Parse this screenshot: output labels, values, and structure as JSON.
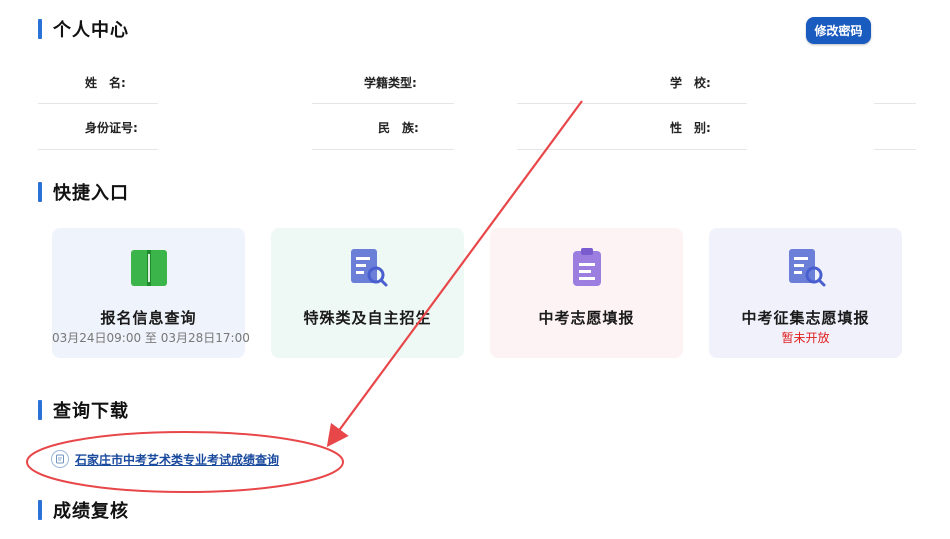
{
  "profile": {
    "title": "个人中心",
    "change_password": "修改密码",
    "fields": {
      "name": "姓　名:",
      "enroll_type": "学籍类型:",
      "school": "学　校:",
      "id_number": "身份证号:",
      "ethnicity": "民　族:",
      "gender": "性　别:"
    }
  },
  "shortcuts": {
    "title": "快捷入口",
    "cards": [
      {
        "name": "报名信息查询",
        "sub": "03月24日09:00 至 03月28日17:00"
      },
      {
        "name": "特殊类及自主招生",
        "sub": ""
      },
      {
        "name": "中考志愿填报",
        "sub": ""
      },
      {
        "name": "中考征集志愿填报",
        "sub": "暂未开放"
      }
    ]
  },
  "downloads": {
    "title": "查询下载",
    "link": "石家庄市中考艺术类专业考试成绩查询",
    "link_icon": "document-icon"
  },
  "review": {
    "title": "成绩复核"
  },
  "colors": {
    "accent": "#2a72d8",
    "button": "#1a5bbf",
    "annotation": "#e8474a",
    "warning": "#e02020"
  }
}
